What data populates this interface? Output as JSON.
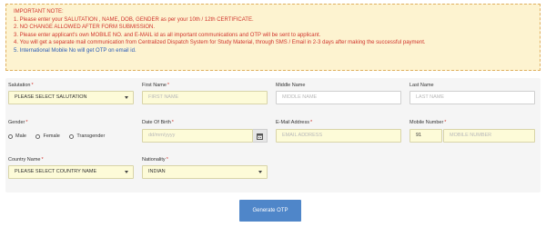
{
  "notice": {
    "heading": "IMPORTANT NOTE:",
    "lines": [
      {
        "text": "1. Please enter your SALUTATION , NAME, DOB, GENDER as per your 10th / 12th CERTIFICATE.",
        "color": "red"
      },
      {
        "text": "2. NO CHANGE ALLOWED AFTER FORM SUBMISSION.",
        "color": "red"
      },
      {
        "text": "3. Please enter applicant's own MOBILE NO. and E-MAIL id as all important communications and OTP will be sent to applicant.",
        "color": "red"
      },
      {
        "text": "4. You will get a separate mail communication from Centralized Dispatch System for Study Material, through SMS / Email in 2-3 days after making the successful payment.",
        "color": "red"
      },
      {
        "text": "5. International Mobile No will get OTP on email id.",
        "color": "blue"
      }
    ]
  },
  "form": {
    "salutation": {
      "label": "Salutation",
      "value": "PLEASE SELECT SALUTATION"
    },
    "first_name": {
      "label": "First Name",
      "placeholder": "FIRST NAME"
    },
    "middle_name": {
      "label": "Middle Name",
      "placeholder": "MIDDLE NAME"
    },
    "last_name": {
      "label": "Last Name",
      "placeholder": "LAST NAME"
    },
    "gender": {
      "label": "Gender",
      "options": [
        "Male",
        "Female",
        "Transgender"
      ]
    },
    "dob": {
      "label": "Date Of Birth",
      "placeholder": "dd/mm/yyyy"
    },
    "email": {
      "label": "E-Mail Address",
      "placeholder": "EMAIL ADDRESS"
    },
    "mobile": {
      "label": "Mobile Number",
      "code": "91",
      "placeholder": "MOBILE NUMBER"
    },
    "country": {
      "label": "Country Name",
      "value": "PLEASE SELECT COUNTRY NAME"
    },
    "nationality": {
      "label": "Nationality",
      "value": "INDIAN"
    }
  },
  "actions": {
    "generate_otp": "Generate OTP"
  },
  "required_mark": "*",
  "colors": {
    "notice_bg": "#fdf3d0",
    "required": "#d0342c",
    "field_bg": "#fdfbd8",
    "button": "#4f86c9"
  }
}
